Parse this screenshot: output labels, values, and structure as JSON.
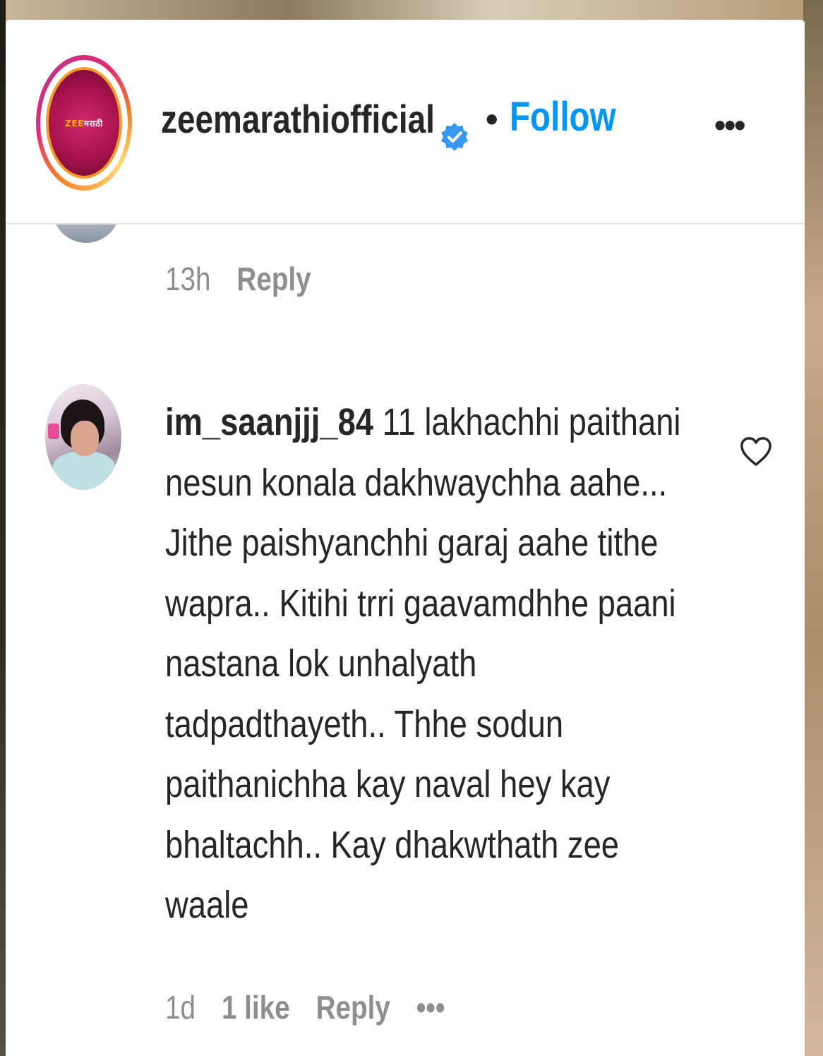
{
  "post_header": {
    "username": "zeemarathiofficial",
    "separator": "•",
    "follow_label": "Follow",
    "more_label": "•••",
    "avatar_logo_prefix": "ZEE",
    "avatar_logo_text": "मराठी",
    "icons": {
      "verified": "verified-badge-icon",
      "more": "more-options-icon"
    },
    "accent_color": "#0095f6"
  },
  "previous_comment": {
    "time": "13h",
    "reply_label": "Reply"
  },
  "comment": {
    "username": "im_saanjjj_84",
    "text": "11 lakhachhi paithani nesun konala dakhwaychha aahe... Jithe paishyanchhi garaj aahe tithe wapra.. Kitihi trri gaavamdhhe paani nastana lok unhalyath tadpadthayeth.. Thhe sodun paithanichha kay naval hey kay bhaltachh.. Kay dhakwthath zee waale",
    "time": "1d",
    "likes": "1 like",
    "reply_label": "Reply",
    "more_label": "•••",
    "icons": {
      "like": "heart-outline-icon"
    }
  }
}
